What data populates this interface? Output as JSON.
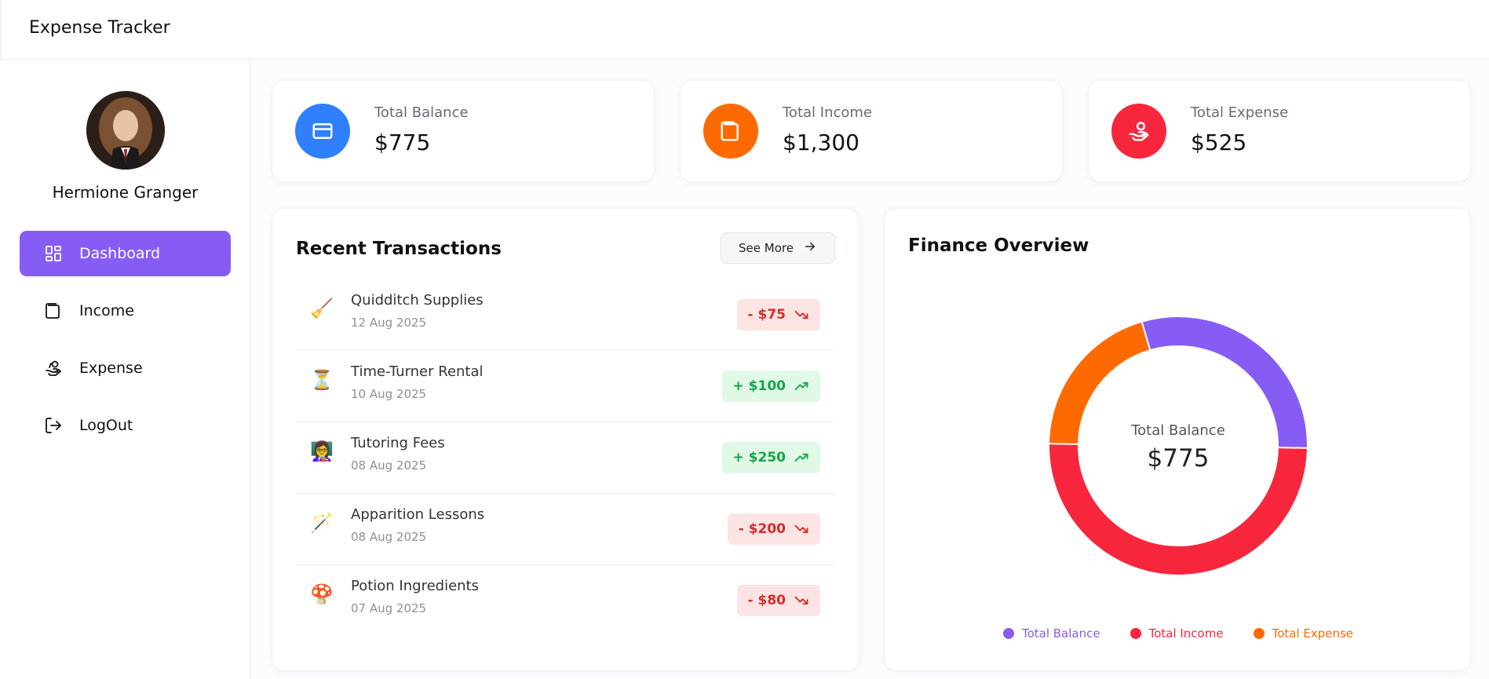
{
  "app": {
    "title": "Expense Tracker"
  },
  "user": {
    "name": "Hermione Granger"
  },
  "sidebar": {
    "items": [
      {
        "label": "Dashboard",
        "icon": "dashboard-grid-icon",
        "active": true
      },
      {
        "label": "Income",
        "icon": "wallet-icon",
        "active": false
      },
      {
        "label": "Expense",
        "icon": "hand-coins-icon",
        "active": false
      },
      {
        "label": "LogOut",
        "icon": "logout-icon",
        "active": false
      }
    ]
  },
  "stats": [
    {
      "label": "Total Balance",
      "value": "$775",
      "icon": "credit-card-icon",
      "color": "#2f80ff"
    },
    {
      "label": "Total Income",
      "value": "$1,300",
      "icon": "wallet-icon",
      "color": "#ff6a00"
    },
    {
      "label": "Total Expense",
      "value": "$525",
      "icon": "hand-coins-icon",
      "color": "#f7263d"
    }
  ],
  "recent": {
    "title": "Recent Transactions",
    "see_more": "See More",
    "transactions": [
      {
        "title": "Quidditch Supplies",
        "date": "12 Aug 2025",
        "amount": "- $75",
        "type": "expense",
        "emoji": "🧹"
      },
      {
        "title": "Time-Turner Rental",
        "date": "10 Aug 2025",
        "amount": "+ $100",
        "type": "income",
        "emoji": "⏳"
      },
      {
        "title": "Tutoring Fees",
        "date": "08 Aug 2025",
        "amount": "+ $250",
        "type": "income",
        "emoji": "👩‍🏫"
      },
      {
        "title": "Apparition Lessons",
        "date": "08 Aug 2025",
        "amount": "- $200",
        "type": "expense",
        "emoji": "🪄"
      },
      {
        "title": "Potion Ingredients",
        "date": "07 Aug 2025",
        "amount": "- $80",
        "type": "expense",
        "emoji": "🍄"
      }
    ]
  },
  "overview": {
    "title": "Finance Overview",
    "center_label": "Total Balance",
    "center_value": "$775"
  },
  "colors": {
    "accent": "#875cf5",
    "balance": "#875cf5",
    "income": "#f7263d",
    "expense": "#ff6a00"
  },
  "chart_data": {
    "type": "pie",
    "categories": [
      "Total Balance",
      "Total Income",
      "Total Expense"
    ],
    "values": [
      775,
      1300,
      525
    ],
    "colors": [
      "#875cf5",
      "#f7263d",
      "#ff6a00"
    ],
    "title": "Finance Overview",
    "legend": "bottom"
  }
}
